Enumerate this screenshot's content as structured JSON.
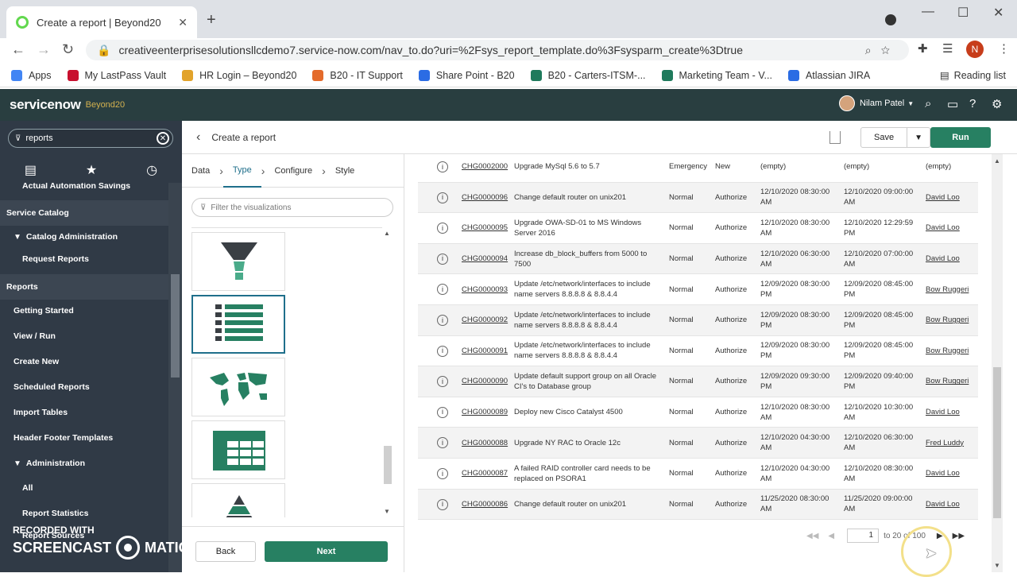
{
  "browser": {
    "tab_title": "Create a report | Beyond20",
    "url": "creativeenterprisesolutionsllcdemo7.service-now.com/nav_to.do?uri=%2Fsys_report_template.do%3Fsysparm_create%3Dtrue",
    "profile_initial": "N",
    "bookmarks": [
      {
        "label": "Apps",
        "color": "#4285f4"
      },
      {
        "label": "My LastPass Vault",
        "color": "#c8102e"
      },
      {
        "label": "HR Login – Beyond20",
        "color": "#e2a32b"
      },
      {
        "label": "B20 - IT Support",
        "color": "#e46b2b"
      },
      {
        "label": "Share Point - B20",
        "color": "#2b6ce4"
      },
      {
        "label": "B20 - Carters-ITSM-...",
        "color": "#1f7a5c"
      },
      {
        "label": "Marketing Team - V...",
        "color": "#1f7a5c"
      },
      {
        "label": "Atlassian JIRA",
        "color": "#2b6ce4"
      }
    ],
    "reading_list": "Reading list"
  },
  "header": {
    "logo": "servicenow",
    "instance": "Beyond20",
    "user": "Nilam Patel",
    "accent": "#293e40"
  },
  "sidebar": {
    "search_value": "reports",
    "items": [
      {
        "label": "Actual Automation Savings",
        "kind": "sub"
      },
      {
        "label": "Service Catalog",
        "kind": "section"
      },
      {
        "label": "Catalog Administration",
        "kind": "group"
      },
      {
        "label": "Request Reports",
        "kind": "sub"
      },
      {
        "label": "Reports",
        "kind": "section"
      },
      {
        "label": "Getting Started",
        "kind": "link"
      },
      {
        "label": "View / Run",
        "kind": "link"
      },
      {
        "label": "Create New",
        "kind": "link"
      },
      {
        "label": "Scheduled Reports",
        "kind": "link"
      },
      {
        "label": "Import Tables",
        "kind": "link"
      },
      {
        "label": "Header Footer Templates",
        "kind": "link"
      },
      {
        "label": "Administration",
        "kind": "group"
      },
      {
        "label": "All",
        "kind": "sub"
      },
      {
        "label": "Report Statistics",
        "kind": "sub"
      },
      {
        "label": "Report Sources",
        "kind": "sub"
      }
    ]
  },
  "watermark": {
    "line1": "RECORDED WITH",
    "line2a": "SCREENCAST",
    "line2b": "MATIC"
  },
  "page": {
    "title": "Create a report",
    "save_label": "Save",
    "run_label": "Run",
    "steps": [
      "Data",
      "Type",
      "Configure",
      "Style"
    ],
    "active_step": "Type",
    "filter_placeholder": "Filter the visualizations",
    "back_label": "Back",
    "next_label": "Next",
    "brand_color": "#278062"
  },
  "table": {
    "rows": [
      {
        "number": "CHG0002000",
        "desc": "Upgrade MySql 5.6 to 5.7",
        "priority": "Emergency",
        "state": "New",
        "start": "(empty)",
        "end": "(empty)",
        "assigned": "(empty)"
      },
      {
        "number": "CHG0000096",
        "desc": "Change default router on unix201",
        "priority": "Normal",
        "state": "Authorize",
        "start": "12/10/2020 08:30:00 AM",
        "end": "12/10/2020 09:00:00 AM",
        "assigned": "David Loo"
      },
      {
        "number": "CHG0000095",
        "desc": "Upgrade OWA-SD-01 to MS Windows Server 2016",
        "priority": "Normal",
        "state": "Authorize",
        "start": "12/10/2020 08:30:00 AM",
        "end": "12/10/2020 12:29:59 PM",
        "assigned": "David Loo"
      },
      {
        "number": "CHG0000094",
        "desc": "Increase db_block_buffers from 5000 to 7500",
        "priority": "Normal",
        "state": "Authorize",
        "start": "12/10/2020 06:30:00 AM",
        "end": "12/10/2020 07:00:00 AM",
        "assigned": "David Loo"
      },
      {
        "number": "CHG0000093",
        "desc": "Update /etc/network/interfaces to include name servers 8.8.8.8 & 8.8.4.4",
        "priority": "Normal",
        "state": "Authorize",
        "start": "12/09/2020 08:30:00 PM",
        "end": "12/09/2020 08:45:00 PM",
        "assigned": "Bow Ruggeri"
      },
      {
        "number": "CHG0000092",
        "desc": "Update /etc/network/interfaces to include name servers 8.8.8.8 & 8.8.4.4",
        "priority": "Normal",
        "state": "Authorize",
        "start": "12/09/2020 08:30:00 PM",
        "end": "12/09/2020 08:45:00 PM",
        "assigned": "Bow Ruggeri"
      },
      {
        "number": "CHG0000091",
        "desc": "Update /etc/network/interfaces to include name servers 8.8.8.8 & 8.8.4.4",
        "priority": "Normal",
        "state": "Authorize",
        "start": "12/09/2020 08:30:00 PM",
        "end": "12/09/2020 08:45:00 PM",
        "assigned": "Bow Ruggeri"
      },
      {
        "number": "CHG0000090",
        "desc": "Update default support group on all Oracle CI's to Database group",
        "priority": "Normal",
        "state": "Authorize",
        "start": "12/09/2020 09:30:00 PM",
        "end": "12/09/2020 09:40:00 PM",
        "assigned": "Bow Ruggeri"
      },
      {
        "number": "CHG0000089",
        "desc": "Deploy new Cisco Catalyst 4500",
        "priority": "Normal",
        "state": "Authorize",
        "start": "12/10/2020 08:30:00 AM",
        "end": "12/10/2020 10:30:00 AM",
        "assigned": "David Loo"
      },
      {
        "number": "CHG0000088",
        "desc": "Upgrade NY RAC to Oracle 12c",
        "priority": "Normal",
        "state": "Authorize",
        "start": "12/10/2020 04:30:00 AM",
        "end": "12/10/2020 06:30:00 AM",
        "assigned": "Fred Luddy"
      },
      {
        "number": "CHG0000087",
        "desc": "A failed RAID controller card needs to be replaced on PSORA1",
        "priority": "Normal",
        "state": "Authorize",
        "start": "12/10/2020 04:30:00 AM",
        "end": "12/10/2020 08:30:00 AM",
        "assigned": "David Loo"
      },
      {
        "number": "CHG0000086",
        "desc": "Change default router on unix201",
        "priority": "Normal",
        "state": "Authorize",
        "start": "11/25/2020 08:30:00 AM",
        "end": "11/25/2020 09:00:00 AM",
        "assigned": "David Loo"
      }
    ]
  },
  "pager": {
    "page": "1",
    "range_text": "to 20 of 100"
  }
}
